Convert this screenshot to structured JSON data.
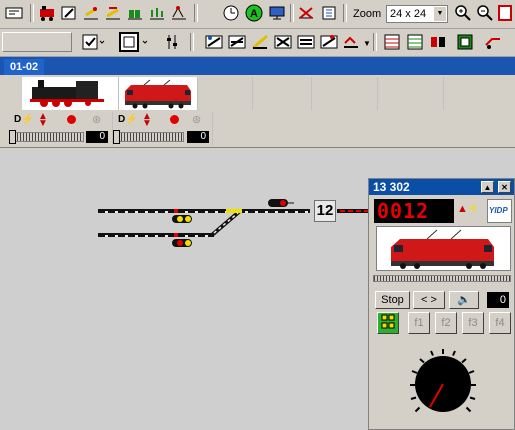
{
  "toolbar1": {
    "zoom_label": "Zoom",
    "zoom_value": "24 x 24",
    "icons": [
      "layout-icon",
      "loco-icon",
      "edit-icon",
      "signal-icon",
      "signal-2-icon",
      "train-icon",
      "route-icon",
      "clock-icon",
      "green-a-icon",
      "monitor-icon",
      "no-entry-icon",
      "road-icon"
    ]
  },
  "toolbar2": {
    "icons": [
      "checkbox-icon",
      "frame-icon",
      "slider-icon",
      "track-1-icon",
      "track-2-icon",
      "track-3-icon",
      "track-4-icon",
      "track-5-icon",
      "track-6-icon",
      "grid-1-icon",
      "grid-2-icon",
      "grid-3-icon",
      "box-icon",
      "wagon-icon"
    ]
  },
  "tabs": [
    {
      "label": "01-02"
    }
  ],
  "loco_strip": {
    "slots": [
      {
        "name": "steam-loco",
        "speed": "0"
      },
      {
        "name": "electric-loco",
        "speed": "0"
      }
    ]
  },
  "layout": {
    "block_number": "12"
  },
  "loco_panel": {
    "title": "13 302",
    "address": "0012",
    "logo_text": "YIDP",
    "stop_label": "Stop",
    "direction_label": "< >",
    "speed_value": "0",
    "functions": [
      "f1",
      "f2",
      "f3",
      "f4"
    ],
    "colors": {
      "title_bg": "#0a4ea6",
      "led": "#e60000"
    }
  }
}
